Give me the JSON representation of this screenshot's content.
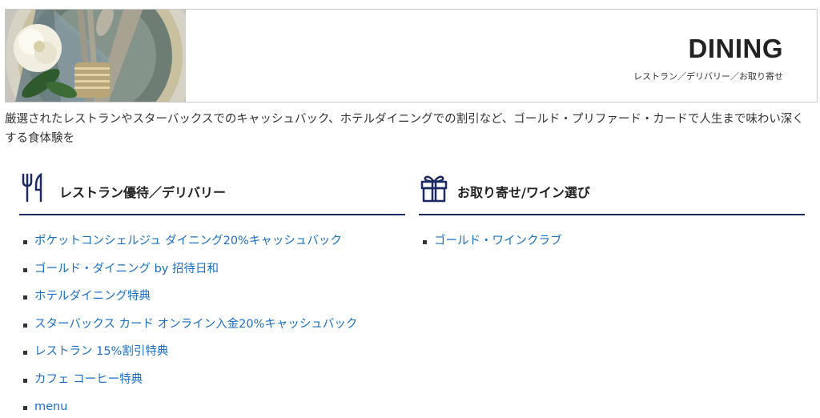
{
  "hero": {
    "title": "DINING",
    "subtitle": "レストラン／デリバリー／お取り寄せ"
  },
  "intro": "厳選されたレストランやスターバックスでのキャッシュバック、ホテルダイニングでの割引など、ゴールド・プリファード・カードで人生まで味わい深くする食体験を",
  "sections": [
    {
      "icon": "fork-knife-icon",
      "title": "レストラン優待／デリバリー",
      "links": [
        "ポケットコンシェルジュ ダイニング20%キャッシュバック",
        "ゴールド・ダイニング by 招待日和",
        "ホテルダイニング特典",
        "スターバックス カード オンライン入金20%キャッシュバック",
        "レストラン 15%割引特典",
        "カフェ コーヒー特典",
        "menu"
      ]
    },
    {
      "icon": "gift-icon",
      "title": "お取り寄せ/ワイン選び",
      "links": [
        "ゴールド・ワインクラブ"
      ]
    }
  ],
  "colors": {
    "accent_rule": "#1b2a63",
    "link": "#1a6fc4",
    "text": "#333333",
    "heading": "#222222"
  }
}
